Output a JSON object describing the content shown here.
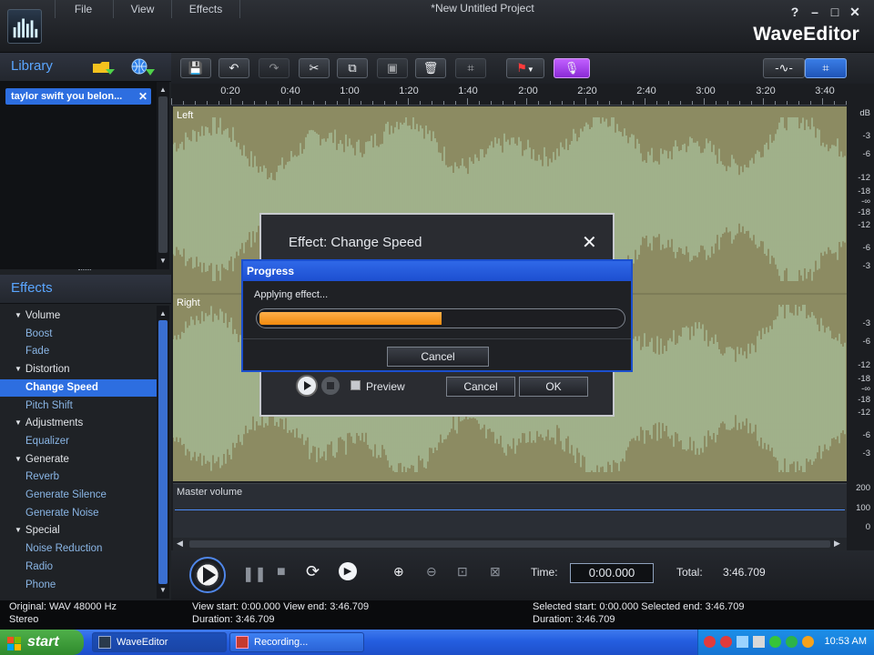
{
  "window": {
    "project_title": "*New Untitled Project",
    "brand": "WaveEditor",
    "menu": [
      "File",
      "View",
      "Effects"
    ],
    "help_label": "?",
    "min_label": "–",
    "max_label": "□",
    "close_label": "✕"
  },
  "library": {
    "title": "Library",
    "items": [
      "taylor swift you belon..."
    ]
  },
  "effects": {
    "title": "Effects",
    "items": [
      {
        "label": "Volume",
        "kind": "category"
      },
      {
        "label": "Boost",
        "kind": "effect"
      },
      {
        "label": "Fade",
        "kind": "effect"
      },
      {
        "label": "Distortion",
        "kind": "category"
      },
      {
        "label": "Change Speed",
        "kind": "effect",
        "selected": true
      },
      {
        "label": "Pitch Shift",
        "kind": "effect"
      },
      {
        "label": "Adjustments",
        "kind": "category"
      },
      {
        "label": "Equalizer",
        "kind": "effect"
      },
      {
        "label": "Generate",
        "kind": "category"
      },
      {
        "label": "Reverb",
        "kind": "effect"
      },
      {
        "label": "Generate Silence",
        "kind": "effect"
      },
      {
        "label": "Generate Noise",
        "kind": "effect"
      },
      {
        "label": "Special",
        "kind": "category"
      },
      {
        "label": "Noise Reduction",
        "kind": "effect"
      },
      {
        "label": "Radio",
        "kind": "effect"
      },
      {
        "label": "Phone",
        "kind": "effect"
      }
    ]
  },
  "ruler": {
    "labels": [
      "0:20",
      "0:40",
      "1:00",
      "1:20",
      "1:40",
      "2:00",
      "2:20",
      "2:40",
      "3:00",
      "3:20",
      "3:40"
    ]
  },
  "waveform": {
    "left_label": "Left",
    "right_label": "Right",
    "db_unit": "dB",
    "left_db": [
      "-3",
      "-6",
      "-12",
      "-18",
      "-∞",
      "-18",
      "-12",
      "-6",
      "-3"
    ],
    "right_db": [
      "-3",
      "-6",
      "-12",
      "-18",
      "-∞",
      "-18",
      "-12",
      "-6",
      "-3"
    ]
  },
  "master_volume": {
    "label": "Master volume",
    "scale": [
      "200",
      "100",
      "0"
    ]
  },
  "transport": {
    "time_label": "Time:",
    "time_value": "0:00.000",
    "total_label": "Total:",
    "total_value": "3:46.709"
  },
  "status": {
    "original_label": "Original:",
    "original_value": "WAV  48000 Hz",
    "channels": "Stereo",
    "view_start_label": "View start:",
    "view_start_value": "0:00.000",
    "view_end_label": "View end:",
    "view_end_value": "3:46.709",
    "duration_label": "Duration:",
    "duration_value": "3:46.709",
    "sel_start_label": "Selected start:",
    "sel_start_value": "0:00.000",
    "sel_end_label": "Selected end:",
    "sel_end_value": "3:46.709",
    "sel_duration_label": "Duration:",
    "sel_duration_value": "3:46.709"
  },
  "effect_dialog": {
    "title": "Effect: Change Speed",
    "preview_label": "Preview",
    "cancel_label": "Cancel",
    "ok_label": "OK"
  },
  "progress_dialog": {
    "title": "Progress",
    "message": "Applying effect...",
    "progress": 0.5,
    "cancel_label": "Cancel"
  },
  "taskbar": {
    "start_label": "start",
    "tasks": [
      "WaveEditor",
      "Recording..."
    ],
    "clock": "10:53 AM"
  },
  "colors": {
    "accent": "#2d6ee0",
    "wave_bg": "#8c8b62",
    "wave_fg": "#a9c19b",
    "progress": "#f28a0e"
  }
}
